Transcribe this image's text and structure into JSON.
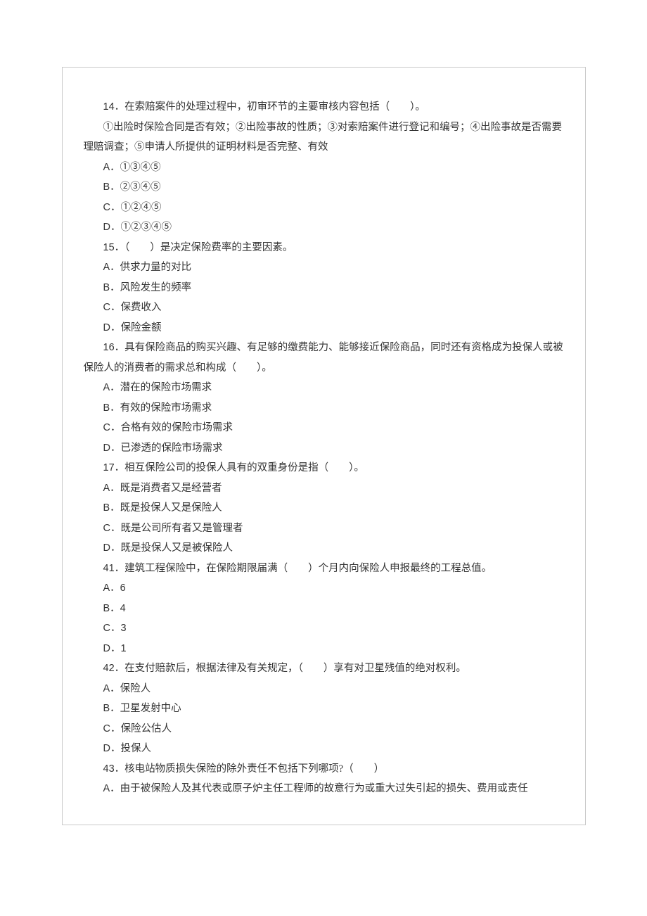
{
  "questions": [
    {
      "num": "14",
      "stem_lines": [
        "．在索赔案件的处理过程中，初审环节的主要审核内容包括（　　）。"
      ],
      "extra_lines": [
        "①出险时保险合同是否有效；②出险事故的性质；③对索赔案件进行登记和编号；④出险事故是否需要理赔调查；⑤申请人所提供的证明材料是否完整、有效"
      ],
      "options": [
        {
          "letter": "A",
          "text": "．①③④⑤"
        },
        {
          "letter": "B",
          "text": "．②③④⑤"
        },
        {
          "letter": "C",
          "text": "．①②④⑤"
        },
        {
          "letter": "D",
          "text": "．①②③④⑤"
        }
      ]
    },
    {
      "num": "15",
      "stem_lines": [
        "．（　　）是决定保险费率的主要因素。"
      ],
      "options": [
        {
          "letter": "A",
          "text": "．供求力量的对比"
        },
        {
          "letter": "B",
          "text": "．风险发生的频率"
        },
        {
          "letter": "C",
          "text": "．保费收入"
        },
        {
          "letter": "D",
          "text": "．保险金额"
        }
      ]
    },
    {
      "num": "16",
      "stem_lines": [
        "．具有保险商品的购买兴趣、有足够的缴费能力、能够接近保险商品，同时还有资格成为投保人或被保险人的消费者的需求总和构成（　　）。"
      ],
      "options": [
        {
          "letter": "A",
          "text": "．潜在的保险市场需求"
        },
        {
          "letter": "B",
          "text": "．有效的保险市场需求"
        },
        {
          "letter": "C",
          "text": "．合格有效的保险市场需求"
        },
        {
          "letter": "D",
          "text": "．已渗透的保险市场需求"
        }
      ]
    },
    {
      "num": "17",
      "stem_lines": [
        "．相互保险公司的投保人具有的双重身份是指（　　）。"
      ],
      "options": [
        {
          "letter": "A",
          "text": "．既是消费者又是经营者"
        },
        {
          "letter": "B",
          "text": "．既是投保人又是保险人"
        },
        {
          "letter": "C",
          "text": "．既是公司所有者又是管理者"
        },
        {
          "letter": "D",
          "text": "．既是投保人又是被保险人"
        }
      ]
    },
    {
      "num": "41",
      "stem_lines": [
        "．建筑工程保险中，在保险期限届满（　　）个月内向保险人申报最终的工程总值。"
      ],
      "options": [
        {
          "letter": "A",
          "text": "．6"
        },
        {
          "letter": "B",
          "text": "．4"
        },
        {
          "letter": "C",
          "text": "．3"
        },
        {
          "letter": "D",
          "text": "．1"
        }
      ]
    },
    {
      "num": "42",
      "stem_lines": [
        "．在支付赔款后，根据法律及有关规定，（　　）享有对卫星残值的绝对权利。"
      ],
      "options": [
        {
          "letter": "A",
          "text": "．保险人"
        },
        {
          "letter": "B",
          "text": "．卫星发射中心"
        },
        {
          "letter": "C",
          "text": "．保险公估人"
        },
        {
          "letter": "D",
          "text": "．投保人"
        }
      ]
    },
    {
      "num": "43",
      "stem_lines": [
        "．核电站物质损失保险的除外责任不包括下列哪项?（　　）"
      ],
      "options": [
        {
          "letter": "A",
          "text": "．由于被保险人及其代表或原子炉主任工程师的故意行为或重大过失引起的损失、费用或责任"
        }
      ]
    }
  ]
}
